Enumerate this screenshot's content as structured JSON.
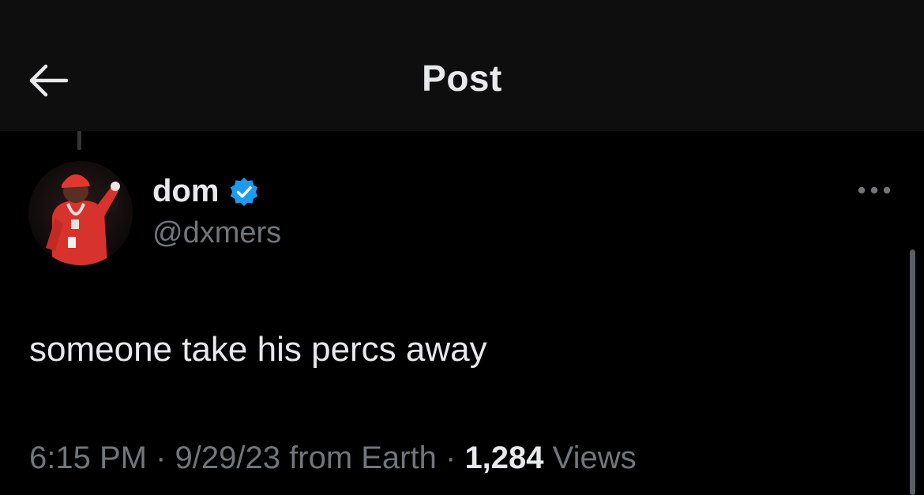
{
  "header": {
    "title": "Post",
    "back_icon": "arrow-left-icon"
  },
  "post": {
    "author": {
      "display_name": "dom",
      "handle": "@dxmers",
      "verified": true,
      "verified_color": "#1d9bf0"
    },
    "text": "someone take his percs away",
    "time": "6:15 PM",
    "separator": "·",
    "date": "9/29/23",
    "source": "from Earth",
    "views_count": "1,284",
    "views_label": "Views"
  },
  "colors": {
    "background": "#000000",
    "header_background": "#0e0e0e",
    "primary_text": "#e7e9ea",
    "secondary_text": "#71767b"
  }
}
